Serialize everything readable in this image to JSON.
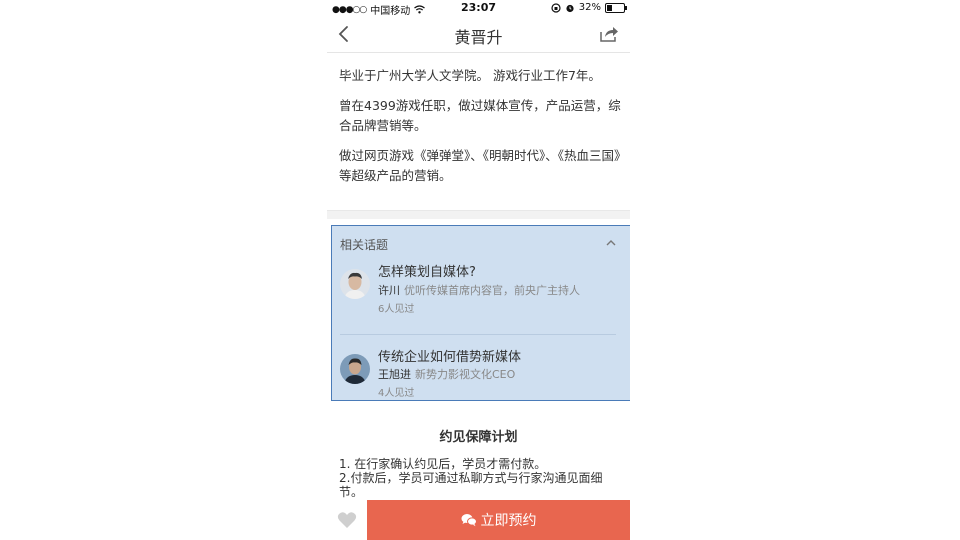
{
  "status_bar": {
    "signal": "●●●○○",
    "carrier": "中国移动",
    "time": "23:07",
    "battery": "32%",
    "battery_level": 0.32
  },
  "nav": {
    "title": "黄晋升"
  },
  "bio": {
    "paragraphs": [
      "毕业于广州大学人文学院。 游戏行业工作7年。",
      "曾在4399游戏任职，做过媒体宣传，产品运营，综合品牌营销等。",
      "做过网页游戏《弹弹堂》、《明朝时代》、《热血三国》等超级产品的营销。"
    ]
  },
  "topics": {
    "header": "相关话题",
    "items": [
      {
        "title": "怎样策划自媒体?",
        "person_name": "许川",
        "person_desc": "优听传媒首席内容官，前央广主持人",
        "count": "6人见过"
      },
      {
        "title": "传统企业如何借势新媒体",
        "person_name": "王旭进",
        "person_desc": "新势力影视文化CEO",
        "count": "4人见过"
      }
    ]
  },
  "guarantee": {
    "title": "约见保障计划",
    "items": [
      "1. 在行家确认约见后，学员才需付款。",
      "2.付款后，学员可通过私聊方式与行家沟通见面细节。"
    ]
  },
  "bottom_bar": {
    "book_label": "立即预约"
  },
  "colors": {
    "accent": "#e8664f",
    "highlight": "#cfdff0"
  }
}
